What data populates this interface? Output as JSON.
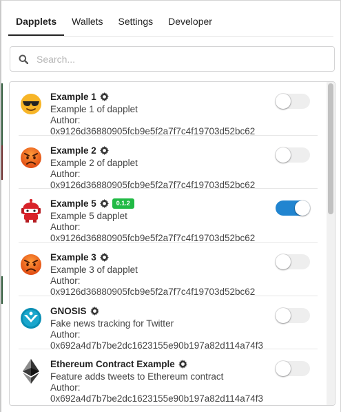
{
  "tabs": [
    {
      "label": "Dapplets",
      "active": true
    },
    {
      "label": "Wallets",
      "active": false
    },
    {
      "label": "Settings",
      "active": false
    },
    {
      "label": "Developer",
      "active": false
    }
  ],
  "search": {
    "placeholder": "Search..."
  },
  "dapplets": [
    {
      "title": "Example 1",
      "description": "Example 1 of dapplet",
      "author_label": "Author:",
      "author": "0x9126d36880905fcb9e5f2a7f7c4f19703d52bc62",
      "icon": "sunglasses-emoji-icon",
      "enabled": false
    },
    {
      "title": "Example 2",
      "description": "Example 2 of dapplet",
      "author_label": "Author:",
      "author": "0x9126d36880905fcb9e5f2a7f7c4f19703d52bc62",
      "icon": "angry-face-emoji-icon",
      "enabled": false
    },
    {
      "title": "Example 5",
      "badge": "0.1.2",
      "description": "Example 5 dapplet",
      "author_label": "Author:",
      "author": "0x9126d36880905fcb9e5f2a7f7c4f19703d52bc62",
      "icon": "red-robot-icon",
      "enabled": true
    },
    {
      "title": "Example 3",
      "description": "Example 3 of dapplet",
      "author_label": "Author:",
      "author": "0x9126d36880905fcb9e5f2a7f7c4f19703d52bc62",
      "icon": "angry-face-emoji-icon",
      "enabled": false
    },
    {
      "title": "GNOSIS",
      "description": "Fake news tracking for Twitter",
      "author_label": "Author:",
      "author": "0x692a4d7b7be2dc1623155e90b197a82d114a74f3",
      "icon": "gnosis-logo-icon",
      "enabled": false
    },
    {
      "title": "Ethereum Contract Example",
      "description": "Feature adds tweets to Ethereum contract",
      "author_label": "Author:",
      "author": "0x692a4d7b7be2dc1623155e90b197a82d114a74f3",
      "icon": "ethereum-logo-icon",
      "enabled": false
    }
  ],
  "colors": {
    "toggle_on": "#2185d0",
    "toggle_off": "#eeeeee",
    "badge": "#21ba45"
  }
}
